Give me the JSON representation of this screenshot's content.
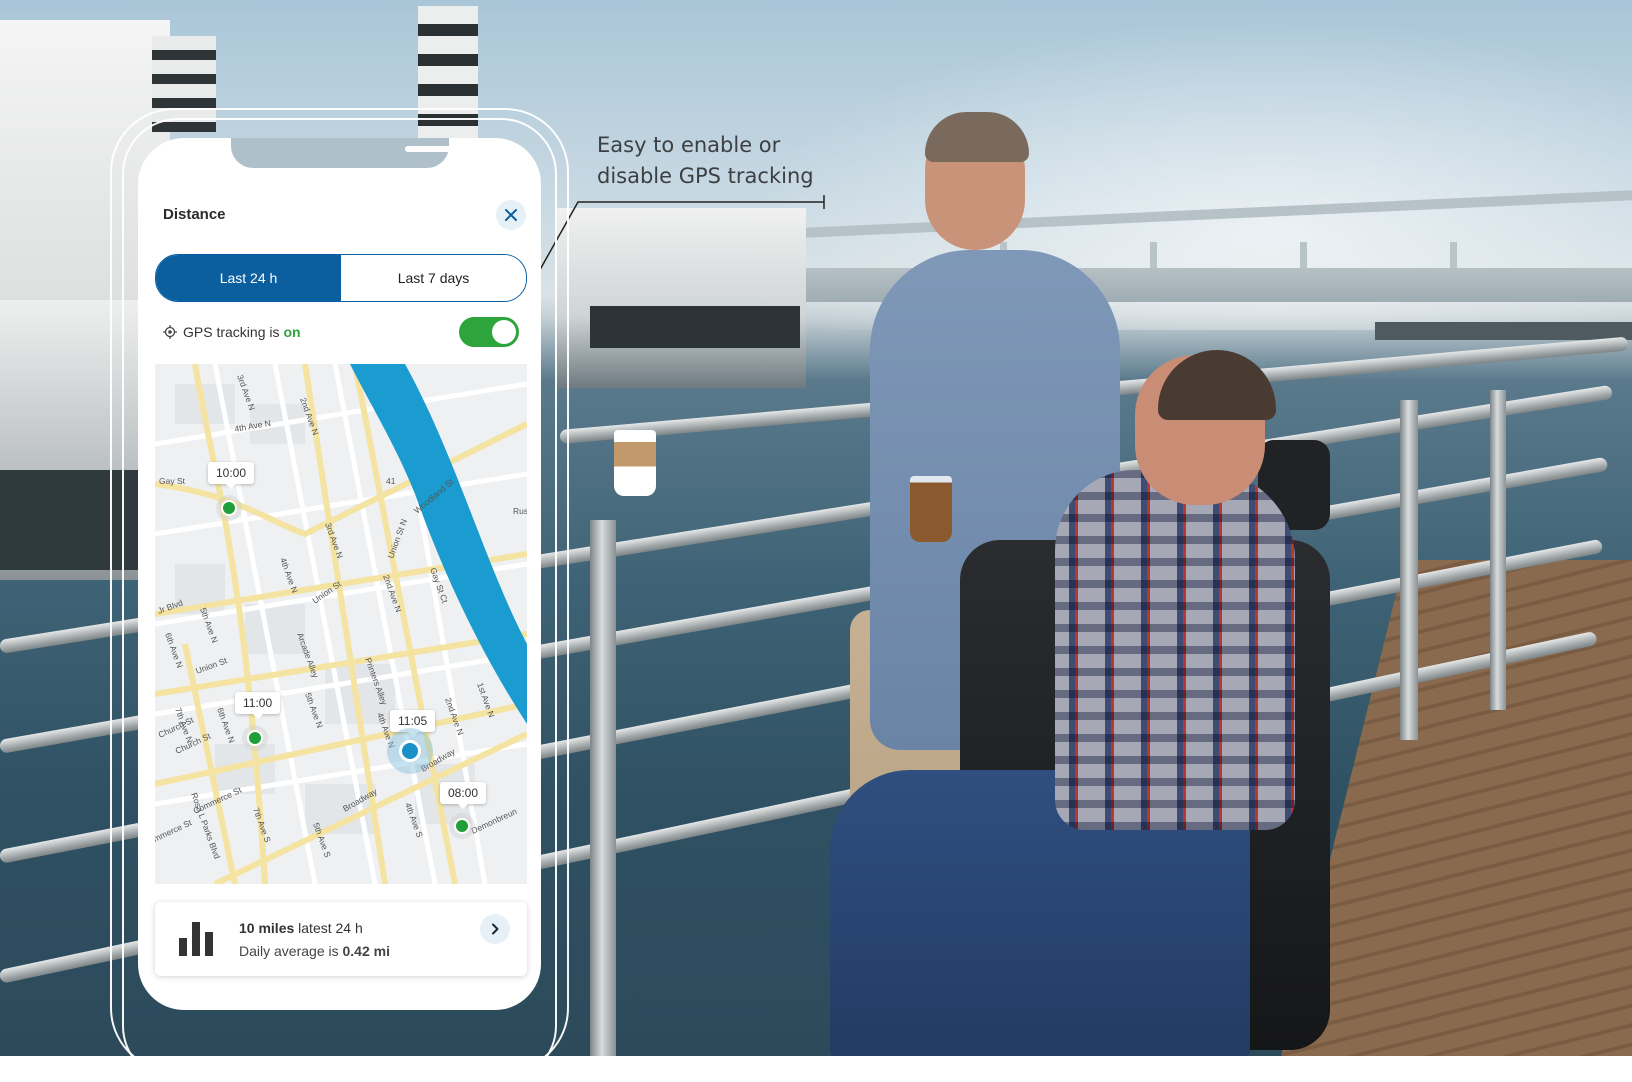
{
  "callout": {
    "line1": "Easy to enable or",
    "line2": "disable GPS tracking"
  },
  "screen": {
    "title": "Distance",
    "close_icon": "close-icon",
    "tabs": [
      {
        "label": "Last 24 h",
        "active": true
      },
      {
        "label": "Last 7 days",
        "active": false
      }
    ],
    "gps": {
      "icon": "location-target-icon",
      "label": "GPS tracking is",
      "state": "on",
      "enabled": true
    },
    "map": {
      "streets": [
        "3rd Ave N",
        "2nd Ave N",
        "4th Ave N",
        "Gay St",
        "41",
        "Woodland St",
        "Union St N",
        "3rd Ave N",
        "4th Ave N",
        "Union St",
        "2nd Ave N",
        "Gay St Ct",
        "5th Ave N",
        "Jr Blvd",
        "6th Ave N",
        "Union St",
        "Arcade Alley",
        "Printers Alley",
        "2nd Ave N",
        "1st Ave N",
        "Church St",
        "7th Ave N",
        "6th Ave N",
        "5th Ave N",
        "4th Ave N",
        "Broadway",
        "Commerce St",
        "Broadway",
        "Rosa L Parks Blvd",
        "Demonbreun",
        "7th Ave S",
        "5th Ave S",
        "4th Ave S",
        "Rus",
        "mmerce St",
        "Church St"
      ],
      "stops": [
        {
          "time": "10:00"
        },
        {
          "time": "11:00"
        },
        {
          "time": "11:05",
          "current": true
        },
        {
          "time": "08:00"
        }
      ]
    },
    "summary": {
      "icon": "bar-chart-icon",
      "distance": "10 miles",
      "distance_suffix": "latest 24 h",
      "avg_prefix": "Daily average is",
      "avg_value": "0.42 mi",
      "chevron_icon": "chevron-right-icon"
    }
  },
  "colors": {
    "accent": "#0c5f9e",
    "on_green": "#2ea43c",
    "water": "#1a9cd0",
    "road_yellow": "#f5e3a1"
  }
}
